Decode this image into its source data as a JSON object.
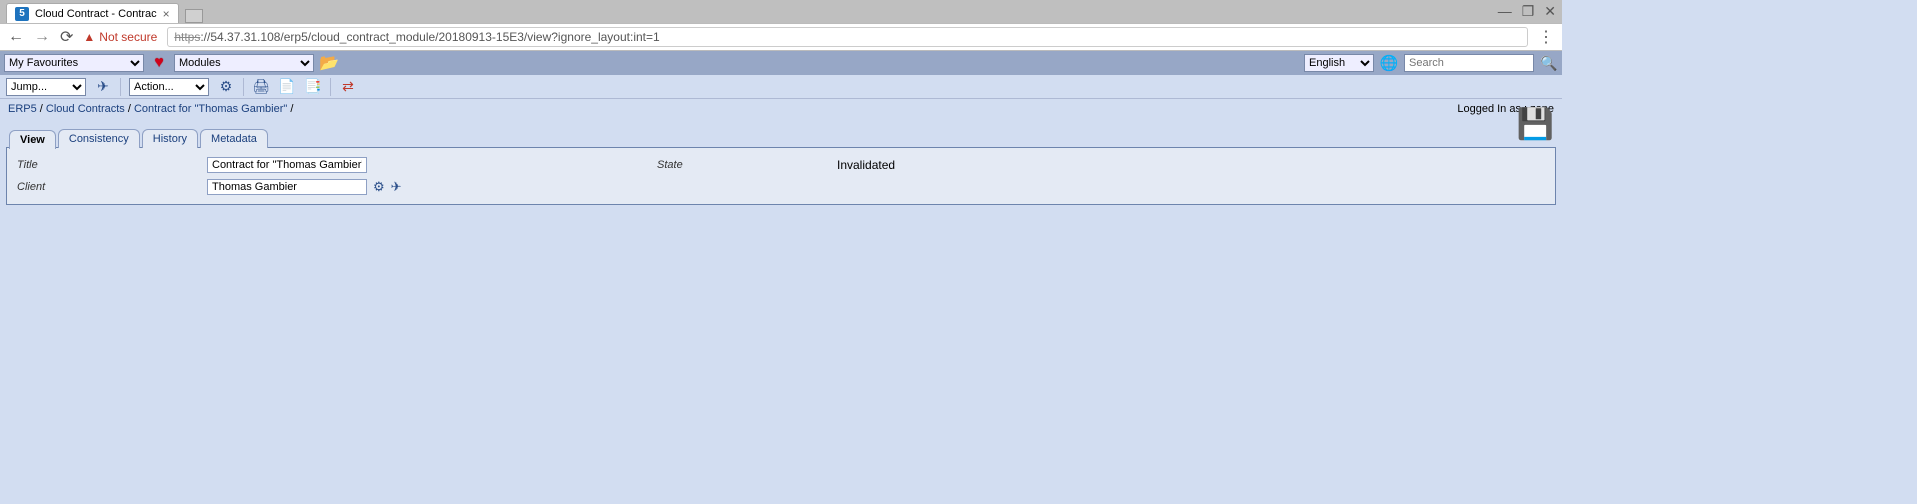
{
  "browser": {
    "tab_title": "Cloud Contract - Contrac",
    "not_secure": "Not secure",
    "url_scheme": "https",
    "url_rest": "://54.37.31.108/erp5/cloud_contract_module/20180913-15E3/view?ignore_layout:int=1"
  },
  "topbar": {
    "favourites": "My Favourites",
    "modules": "Modules",
    "language": "English",
    "search_placeholder": "Search"
  },
  "bar2": {
    "jump": "Jump...",
    "action": "Action..."
  },
  "breadcrumb": {
    "a": "ERP5",
    "b": "Cloud Contracts",
    "c": "Contract for \"Thomas Gambier\"",
    "sep": " / "
  },
  "login_label": "Logged In as : ",
  "login_user": "zope",
  "tabs": {
    "view": "View",
    "consistency": "Consistency",
    "history": "History",
    "metadata": "Metadata"
  },
  "form": {
    "title_label": "Title",
    "title_value": "Contract for \"Thomas Gambier\"",
    "client_label": "Client",
    "client_value": "Thomas Gambier",
    "state_label": "State",
    "state_value": "Invalidated"
  }
}
